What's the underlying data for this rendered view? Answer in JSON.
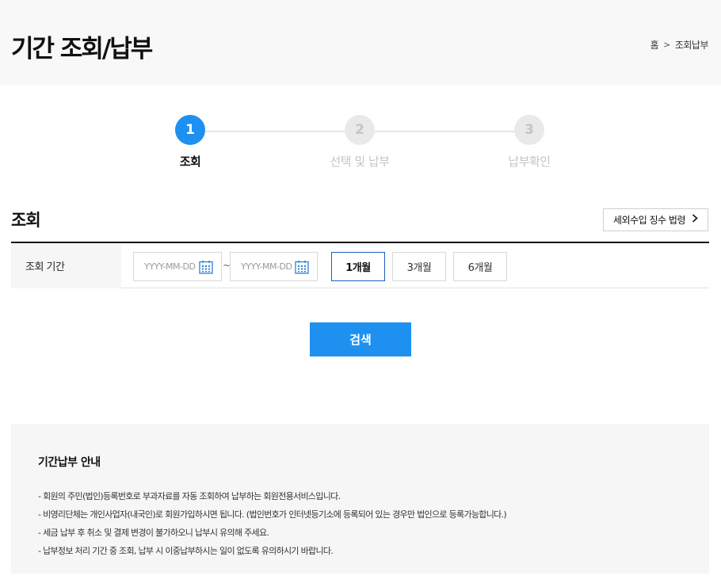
{
  "header": {
    "title": "기간 조회/납부",
    "breadcrumb": {
      "home": "홈",
      "separator": ">",
      "current": "조회납부"
    }
  },
  "steps": [
    {
      "number": "1",
      "label": "조회",
      "active": true
    },
    {
      "number": "2",
      "label": "선택 및 납부",
      "active": false
    },
    {
      "number": "3",
      "label": "납부확인",
      "active": false
    }
  ],
  "section": {
    "title": "조회",
    "law_button_label": "세외수입 징수 법령",
    "law_button_icon": "chevron-right-icon"
  },
  "form": {
    "period_label": "조회 기간",
    "start_date": {
      "value": "",
      "placeholder": "YYYY-MM-DD"
    },
    "range_separator": "~",
    "end_date": {
      "value": "",
      "placeholder": "YYYY-MM-DD"
    },
    "period_buttons": [
      "1개월",
      "3개월",
      "6개월"
    ],
    "selected_period": "1개월",
    "calendar_icon": "calendar-icon"
  },
  "search_button_label": "검색",
  "guide": {
    "title": "기간납부 안내",
    "items": [
      "-  회원의 주민(법인)등록번호로 부과자료를 자동 조회하여 납부하는 회원전용서비스입니다.",
      "-  비영리단체는 개인사업자(내국인)로 회원가입하시면 됩니다. (법인번호가 인터넷등기소에 등록되어 있는 경우만 법인으로 등록가능합니다.)",
      "-  세금 납부 후 취소 및 결제 변경이 불가하오니 납부시 유의해 주세요.",
      "-  납부정보 처리 기간 중 조회, 납부 시 이중납부하시는 일이 없도록 유의하시기 바랍니다."
    ]
  },
  "colors": {
    "accent": "#1e90f0",
    "header_bg": "#f8f8f9",
    "inactive_step": "#e9e9ea",
    "selected_border": "#1e5fbf"
  }
}
